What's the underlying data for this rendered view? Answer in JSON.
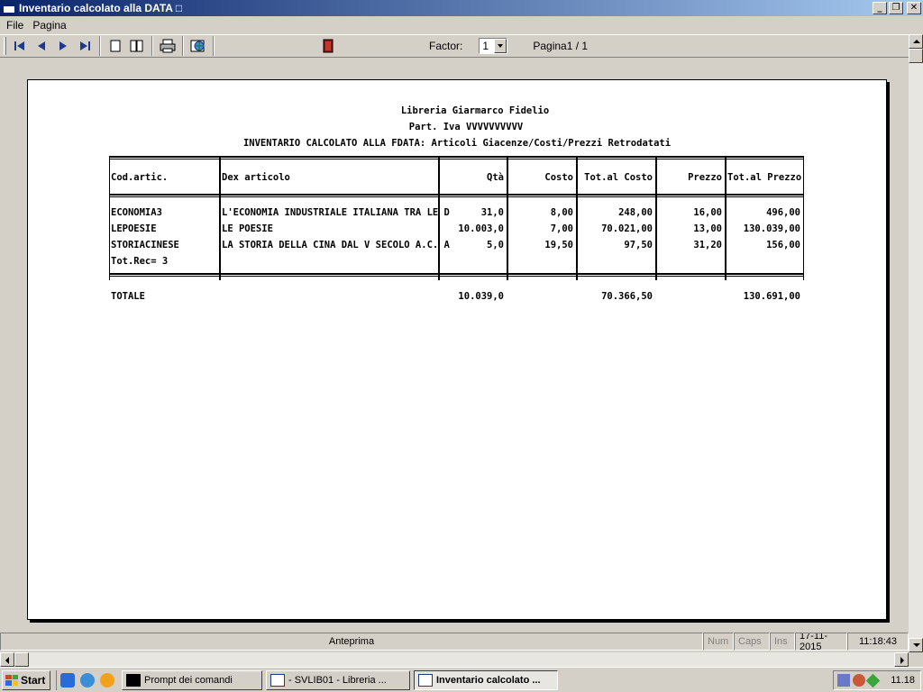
{
  "window": {
    "title": "Inventario calcolato alla DATA □"
  },
  "menu": [
    "File",
    "Pagina"
  ],
  "toolbar": {
    "factor_label": "Factor:",
    "factor_value": "1",
    "page_label": "Pagina1 / 1"
  },
  "report": {
    "company": "Libreria Giarmarco Fidelio",
    "vat": "Part. Iva   VVVVVVVVVV",
    "title": "INVENTARIO CALCOLATO ALLA FDATA: Articoli Giacenze/Costi/Prezzi Retrodatati",
    "columns": [
      "Cod.artic.",
      "Dex articolo",
      "Qtà",
      "Costo",
      "Tot.al Costo",
      "Prezzo",
      "Tot.al Prezzo"
    ],
    "rows": [
      [
        "ECONOMIA3",
        "L'ECONOMIA INDUSTRIALE ITALIANA TRA LE D",
        "31,0",
        "8,00",
        "248,00",
        "16,00",
        "496,00"
      ],
      [
        "LEPOESIE",
        "LE POESIE",
        "10.003,0",
        "7,00",
        "70.021,00",
        "13,00",
        "130.039,00"
      ],
      [
        "STORIACINESE",
        "LA STORIA DELLA CINA DAL V SECOLO A.C. A",
        "5,0",
        "19,50",
        "97,50",
        "31,20",
        "156,00"
      ]
    ],
    "rec_count": "Tot.Rec= 3",
    "totals": {
      "label": "TOTALE",
      "qty": "10.039,0",
      "cost_total": "70.366,50",
      "price_total": "130.691,00"
    }
  },
  "status": {
    "main": "Anteprima",
    "num": "Num",
    "caps": "Caps",
    "ins": "Ins",
    "date": "17-11-2015",
    "time": "11:18:43"
  },
  "taskbar": {
    "start": "Start",
    "tasks": [
      {
        "label": "Prompt dei comandi",
        "active": false
      },
      {
        "label": "- SVLIB01 - Libreria       ...",
        "active": false
      },
      {
        "label": "Inventario calcolato ...",
        "active": true
      }
    ],
    "clock": "11.18"
  }
}
